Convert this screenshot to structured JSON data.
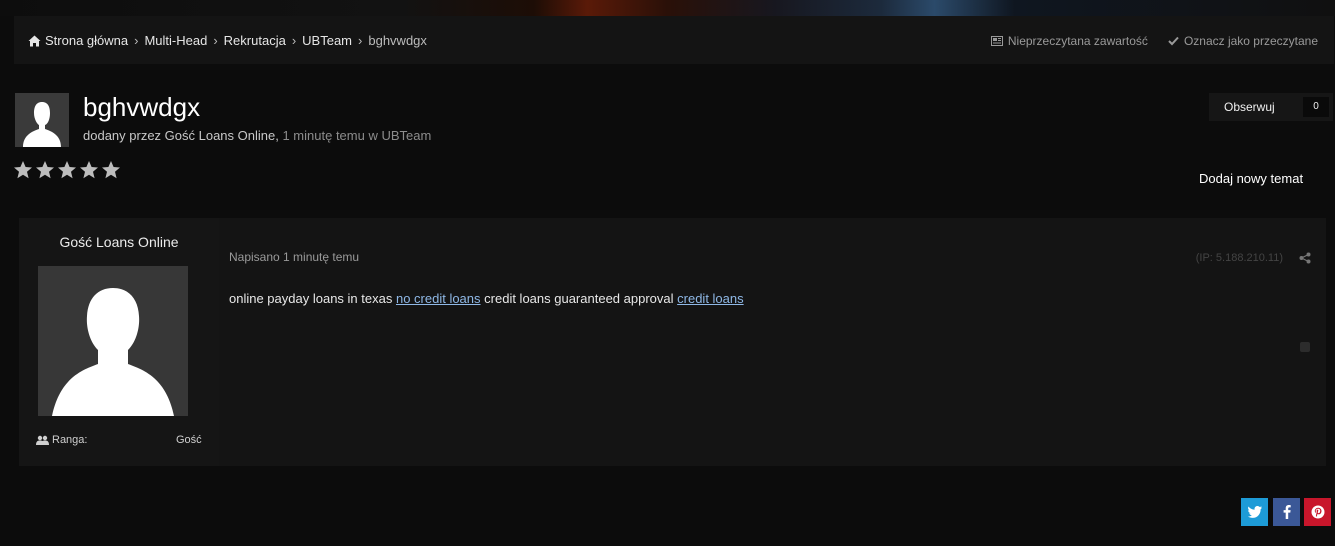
{
  "breadcrumb": {
    "items": [
      "Strona główna",
      "Multi-Head",
      "Rekrutacja",
      "UBTeam"
    ],
    "current": "bghvwdgx"
  },
  "top_actions": {
    "unread": "Nieprzeczytana zawartość",
    "mark_read": "Oznacz jako przeczytane"
  },
  "topic": {
    "title": "bghvwdgx",
    "byline_prefix": "dodany przez Gość Loans Online,",
    "byline_time": "1 minutę temu w UBTeam",
    "rating_stars": 0
  },
  "follow": {
    "label": "Obserwuj",
    "count": "0"
  },
  "new_topic_label": "Dodaj nowy temat",
  "post": {
    "author": "Gość Loans Online",
    "rank_label": "Ranga:",
    "rank_value": "Gość",
    "posted": "Napisano 1 minutę temu",
    "ip": "(IP: 5.188.210.11)",
    "text_1": "online payday loans in texas",
    "link_1": "no credit loans",
    "text_2": "credit loans guaranteed approval",
    "link_2": "credit loans"
  },
  "colors": {
    "background": "#0c0c0c",
    "panel": "#141414",
    "link": "#8fb8e6",
    "twitter": "#1d9bd7",
    "facebook": "#3b5897",
    "pinterest": "#c8162b"
  },
  "icons": {
    "home": "home-icon",
    "unread": "newspaper-icon",
    "mark_read": "check-icon",
    "rank": "users-icon",
    "share": "share-icon",
    "twitter": "twitter-icon",
    "facebook": "facebook-icon",
    "pinterest": "pinterest-icon"
  }
}
